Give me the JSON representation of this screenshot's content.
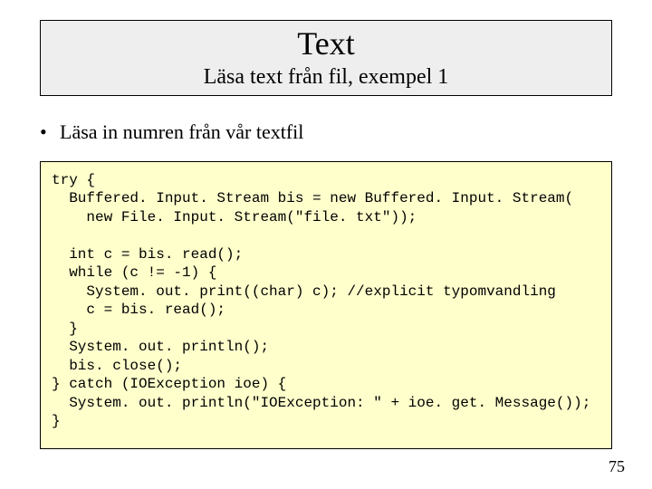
{
  "header": {
    "title": "Text",
    "subtitle": "Läsa text från fil, exempel 1"
  },
  "bullets": [
    "Läsa in numren från vår textfil"
  ],
  "code": "try {\n  Buffered. Input. Stream bis = new Buffered. Input. Stream(\n    new File. Input. Stream(\"file. txt\"));\n\n  int c = bis. read();\n  while (c != -1) {\n    System. out. print((char) c); //explicit typomvandling\n    c = bis. read();\n  }\n  System. out. println();\n  bis. close();\n} catch (IOException ioe) {\n  System. out. println(\"IOException: \" + ioe. get. Message());\n}",
  "page_number": "75"
}
